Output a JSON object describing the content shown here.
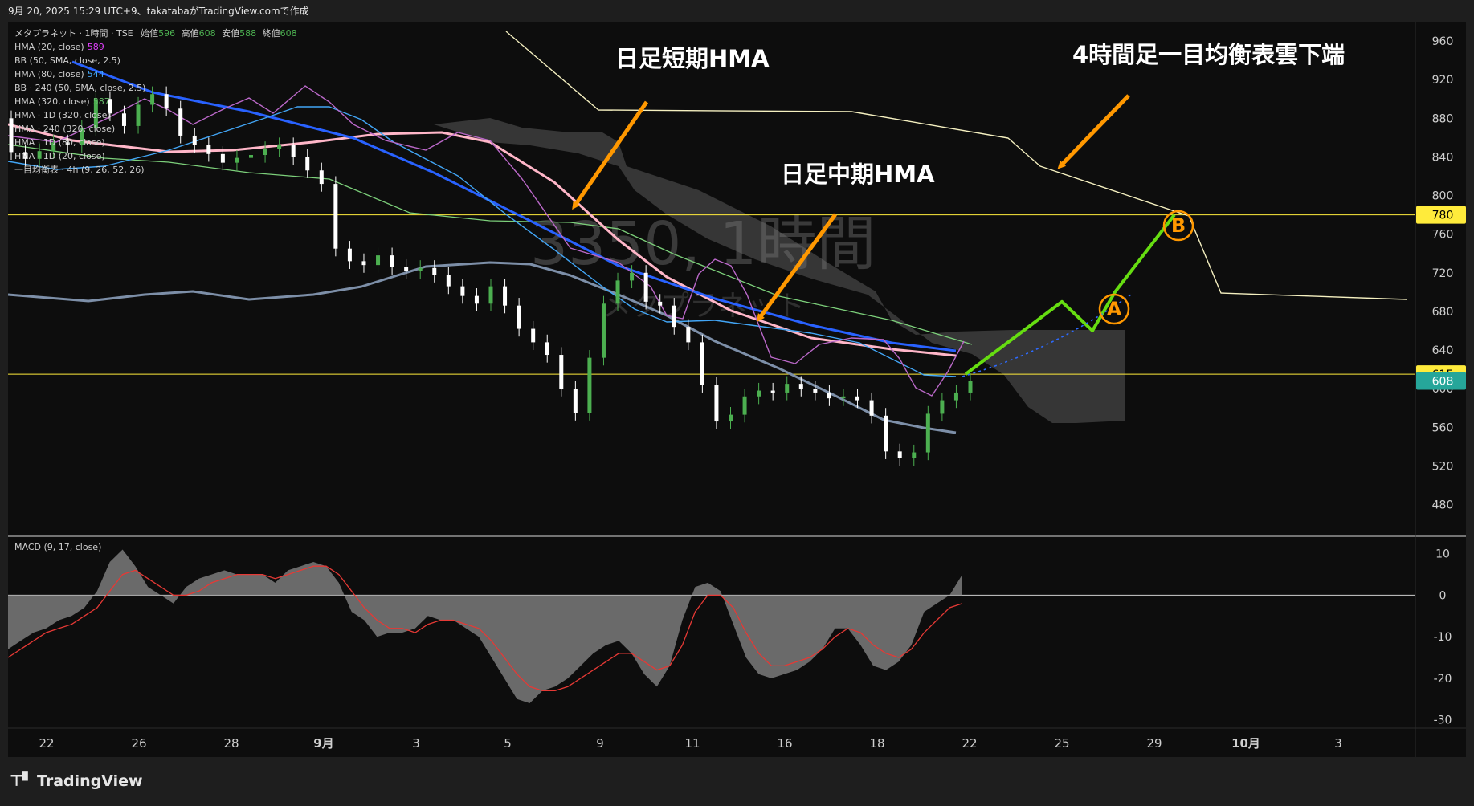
{
  "header": {
    "snapshot_text": "9月 20, 2025 15:29 UTC+9、takatabaがTradingView.comで作成"
  },
  "legend": {
    "symbol_line": "メタプラネット · 1時間 · TSE",
    "open_label": "始値",
    "open_value": "596",
    "high_label": "高値",
    "high_value": "608",
    "low_label": "安値",
    "low_value": "588",
    "close_label": "終値",
    "close_value": "608",
    "indicators": [
      {
        "name": "HMA (20, close)",
        "value": "589",
        "color": "#e040fb"
      },
      {
        "name": "BB (50, SMA, close, 2.5)",
        "value": "",
        "color": "#cfcfcf"
      },
      {
        "name": "HMA (80, close)",
        "value": "544",
        "color": "#42a5f5"
      },
      {
        "name": "BB · 240 (50, SMA, close, 2.5)",
        "value": "",
        "color": "#cfcfcf"
      },
      {
        "name": "HMA (320, close)",
        "value": "587",
        "color": "#66bb6a"
      },
      {
        "name": "HMA · 1D (320, close)",
        "value": "",
        "color": "#cfcfcf"
      },
      {
        "name": "HMA · 240 (320, close)",
        "value": "",
        "color": "#cfcfcf"
      },
      {
        "name": "HMA · 1D (80, close)",
        "value": "",
        "color": "#cfcfcf"
      },
      {
        "name": "HMA · 1D (20, close)",
        "value": "",
        "color": "#cfcfcf"
      },
      {
        "name": "一目均衡表 · 4h (9, 26, 52, 26)",
        "value": "",
        "color": "#cfcfcf"
      }
    ]
  },
  "watermark": {
    "symbol": "3350, 1時間",
    "name": "メタプラネット"
  },
  "annotations": {
    "short_hma": "日足短期HMA",
    "mid_hma": "日足中期HMA",
    "cloud_bottom": "4時間足一目均衡表雲下端",
    "marker_a": "A",
    "marker_b": "B"
  },
  "price_badges": [
    {
      "value": "780",
      "bg": "#ffeb3b",
      "fg": "#000000"
    },
    {
      "value": "615",
      "bg": "#ffeb3b",
      "fg": "#000000"
    },
    {
      "value": "608",
      "bg": "#26a69a",
      "fg": "#ffffff"
    }
  ],
  "macd": {
    "label": "MACD (9, 17, close)"
  },
  "footer": {
    "brand": "TradingView"
  },
  "colors": {
    "bull": "#4caf50",
    "bear": "#ffffff",
    "projection": "#66dd11",
    "arrow": "#ff9800",
    "short_hma": "#ffb6c8",
    "mid_hma": "#2962ff",
    "cloud_edge": "#f5f0c0"
  },
  "chart_data": [
    {
      "type": "candlestick",
      "title": "",
      "x_tick_labels": [
        "22",
        "26",
        "28",
        "9月",
        "3",
        "5",
        "9",
        "11",
        "16",
        "18",
        "22",
        "25",
        "29",
        "10月",
        "3"
      ],
      "y_tick_labels": [
        "960",
        "920",
        "880",
        "840",
        "800",
        "760",
        "720",
        "680",
        "640",
        "600",
        "560",
        "520",
        "480"
      ],
      "ylim": [
        448,
        980
      ],
      "horizontal_lines": [
        780,
        615,
        608
      ],
      "last_close": 608,
      "candles_approx": [
        [
          880,
          845
        ],
        [
          845,
          838
        ],
        [
          838,
          846
        ],
        [
          846,
          855
        ],
        [
          855,
          852
        ],
        [
          852,
          870
        ],
        [
          870,
          900
        ],
        [
          900,
          885
        ],
        [
          885,
          872
        ],
        [
          872,
          894
        ],
        [
          894,
          905
        ],
        [
          905,
          890
        ],
        [
          890,
          862
        ],
        [
          862,
          852
        ],
        [
          852,
          843
        ],
        [
          843,
          834
        ],
        [
          834,
          839
        ],
        [
          839,
          842
        ],
        [
          842,
          848
        ],
        [
          848,
          852
        ],
        [
          852,
          840
        ],
        [
          840,
          826
        ],
        [
          826,
          812
        ],
        [
          812,
          745
        ],
        [
          745,
          732
        ],
        [
          732,
          728
        ],
        [
          728,
          738
        ],
        [
          738,
          726
        ],
        [
          726,
          722
        ],
        [
          722,
          725
        ],
        [
          725,
          718
        ],
        [
          718,
          706
        ],
        [
          706,
          696
        ],
        [
          696,
          688
        ],
        [
          688,
          706
        ],
        [
          706,
          686
        ],
        [
          686,
          662
        ],
        [
          662,
          648
        ],
        [
          648,
          635
        ],
        [
          635,
          600
        ],
        [
          600,
          575
        ],
        [
          575,
          632
        ],
        [
          632,
          688
        ],
        [
          688,
          712
        ],
        [
          712,
          720
        ],
        [
          720,
          690
        ],
        [
          690,
          686
        ],
        [
          686,
          664
        ],
        [
          664,
          648
        ],
        [
          648,
          604
        ],
        [
          604,
          566
        ],
        [
          566,
          573
        ],
        [
          573,
          592
        ],
        [
          592,
          598
        ],
        [
          598,
          596
        ],
        [
          596,
          605
        ],
        [
          605,
          600
        ],
        [
          600,
          596
        ],
        [
          596,
          590
        ],
        [
          590,
          592
        ],
        [
          592,
          588
        ],
        [
          588,
          572
        ],
        [
          572,
          535
        ],
        [
          535,
          528
        ],
        [
          528,
          534
        ],
        [
          534,
          574
        ],
        [
          574,
          588
        ],
        [
          588,
          596
        ],
        [
          596,
          608
        ]
      ],
      "projection_path": [
        [
          615,
          "A-start"
        ],
        [
          690,
          ""
        ],
        [
          660,
          ""
        ],
        [
          700,
          "A"
        ],
        [
          780,
          "B"
        ]
      ]
    },
    {
      "type": "area",
      "title": "MACD (9, 17, close)",
      "y_tick_labels": [
        "10",
        "0",
        "-10",
        "-20",
        "-30"
      ],
      "ylim": [
        -32,
        14
      ],
      "series": [
        {
          "values": [
            -13,
            -11,
            -9,
            -8,
            -6,
            -5,
            -3,
            1,
            8,
            11,
            7,
            2,
            0,
            -2,
            2,
            4,
            5,
            6,
            5,
            5,
            5,
            3,
            6,
            7,
            8,
            7,
            3,
            -4,
            -6,
            -10,
            -9,
            -9,
            -8,
            -5,
            -6,
            -6,
            -8,
            -10,
            -15,
            -20,
            -25,
            -26,
            -23,
            -22,
            -20,
            -17,
            -14,
            -12,
            -11,
            -14,
            -19,
            -22,
            -17,
            -6,
            2,
            3,
            1,
            -7,
            -15,
            -19,
            -20,
            -19,
            -18,
            -16,
            -13,
            -8,
            -8,
            -12,
            -17,
            -18,
            -16,
            -12,
            -4,
            -2,
            0,
            5
          ]
        },
        {
          "values": [
            -15,
            -13,
            -11,
            -9,
            -8,
            -7,
            -5,
            -3,
            1,
            5,
            6,
            4,
            2,
            0,
            0,
            1,
            3,
            4,
            5,
            5,
            5,
            4,
            5,
            6,
            7,
            7,
            5,
            1,
            -3,
            -6,
            -8,
            -8,
            -9,
            -7,
            -6,
            -6,
            -7,
            -8,
            -11,
            -15,
            -19,
            -22,
            -23,
            -23,
            -22,
            -20,
            -18,
            -16,
            -14,
            -14,
            -16,
            -18,
            -17,
            -12,
            -4,
            0,
            0,
            -3,
            -9,
            -14,
            -17,
            -17,
            -16,
            -15,
            -13,
            -10,
            -8,
            -9,
            -12,
            -14,
            -15,
            -13,
            -9,
            -6,
            -3,
            -2
          ]
        }
      ]
    }
  ]
}
